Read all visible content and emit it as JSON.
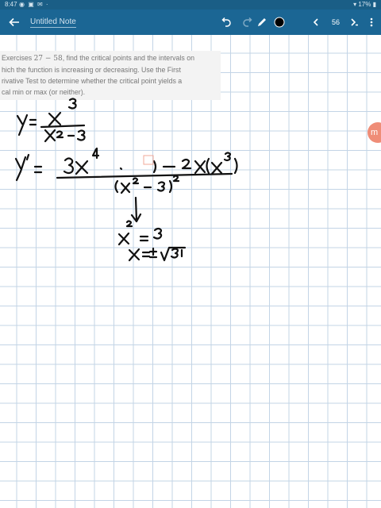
{
  "status_bar": {
    "time": "8:47",
    "notification_icons": "◉ ▣ ✉ ·",
    "battery": "17%"
  },
  "app_bar": {
    "title": "Untitled Note",
    "page_number": "56"
  },
  "exercise": {
    "line1_prefix": "Exercises ",
    "range_start": "27",
    "range_dash": " − ",
    "range_end": "58",
    "line1_suffix": ", find the critical points and the intervals on",
    "line2": "hich the function is increasing or decreasing. Use the First",
    "line3": "rivative Test to determine whether the critical point yields a",
    "line4": "cal min or max (or neither)."
  },
  "fab": {
    "label": "m"
  },
  "colors": {
    "app_bar": "#1b6694",
    "status_bar": "#1a5e86",
    "grid": "#c3d4e6",
    "ink": "#111111",
    "accent": "#ef8d77"
  },
  "icons": {
    "back": "arrow-left-icon",
    "undo": "undo-icon",
    "redo": "redo-icon",
    "pen": "pen-icon",
    "color": "color-dot-icon",
    "prev": "chevron-left-icon",
    "next": "chevron-right-icon",
    "more": "more-vertical-icon"
  }
}
